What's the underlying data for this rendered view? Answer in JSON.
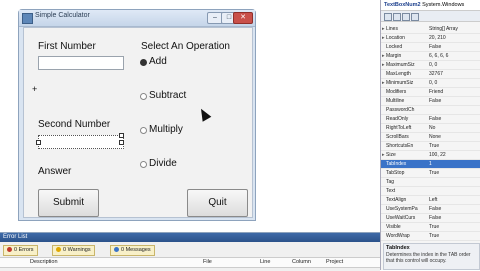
{
  "form": {
    "title": "Simple Calculator",
    "first_number_label": "First Number",
    "second_number_label": "Second Number",
    "answer_label": "Answer",
    "operation_label": "Select An Operation",
    "stray_char": "+",
    "radios": [
      {
        "label": "Add",
        "checked": true
      },
      {
        "label": "Subtract",
        "checked": false
      },
      {
        "label": "Multiply",
        "checked": false
      },
      {
        "label": "Divide",
        "checked": false
      }
    ],
    "submit_label": "Submit",
    "quit_label": "Quit"
  },
  "properties": {
    "object_name": "TextBoxNum2",
    "object_type": "System.Windows",
    "rows": [
      {
        "name": "Lines",
        "value": "String[] Array",
        "expand": true
      },
      {
        "name": "Location",
        "value": "20, 210",
        "expand": true
      },
      {
        "name": "Locked",
        "value": "False",
        "expand": false
      },
      {
        "name": "Margin",
        "value": "6, 6, 6, 6",
        "expand": true
      },
      {
        "name": "MaximumSiz",
        "value": "0, 0",
        "expand": true
      },
      {
        "name": "MaxLength",
        "value": "32767",
        "expand": false
      },
      {
        "name": "MinimumSiz",
        "value": "0, 0",
        "expand": true
      },
      {
        "name": "Modifiers",
        "value": "Friend",
        "expand": false
      },
      {
        "name": "Multiline",
        "value": "False",
        "expand": false
      },
      {
        "name": "PasswordCh",
        "value": "",
        "expand": false
      },
      {
        "name": "ReadOnly",
        "value": "False",
        "expand": false
      },
      {
        "name": "RightToLeft",
        "value": "No",
        "expand": false
      },
      {
        "name": "ScrollBars",
        "value": "None",
        "expand": false
      },
      {
        "name": "ShortcutsEn",
        "value": "True",
        "expand": false
      },
      {
        "name": "Size",
        "value": "100, 22",
        "expand": true
      },
      {
        "name": "TabIndex",
        "value": "1",
        "expand": false,
        "selected": true
      },
      {
        "name": "TabStop",
        "value": "True",
        "expand": false
      },
      {
        "name": "Tag",
        "value": "",
        "expand": false
      },
      {
        "name": "Text",
        "value": "",
        "expand": false
      },
      {
        "name": "TextAlign",
        "value": "Left",
        "expand": false
      },
      {
        "name": "UseSystemPa",
        "value": "False",
        "expand": false
      },
      {
        "name": "UseWaitCurs",
        "value": "False",
        "expand": false
      },
      {
        "name": "Visible",
        "value": "True",
        "expand": false
      },
      {
        "name": "WordWrap",
        "value": "True",
        "expand": false
      }
    ],
    "desc_title": "TabIndex",
    "desc_text": "Determines the index in the TAB order that this control will occupy."
  },
  "error_list": {
    "title": "Error List",
    "errors_label": "0 Errors",
    "warnings_label": "0 Warnings",
    "messages_label": "0 Messages",
    "columns": [
      "Description",
      "File",
      "Line",
      "Column",
      "Project"
    ]
  },
  "colors": {
    "selected_row": "#3a73c8",
    "error_icon": "#c0392b",
    "warning_icon": "#e0a800",
    "message_icon": "#3a73c8"
  }
}
